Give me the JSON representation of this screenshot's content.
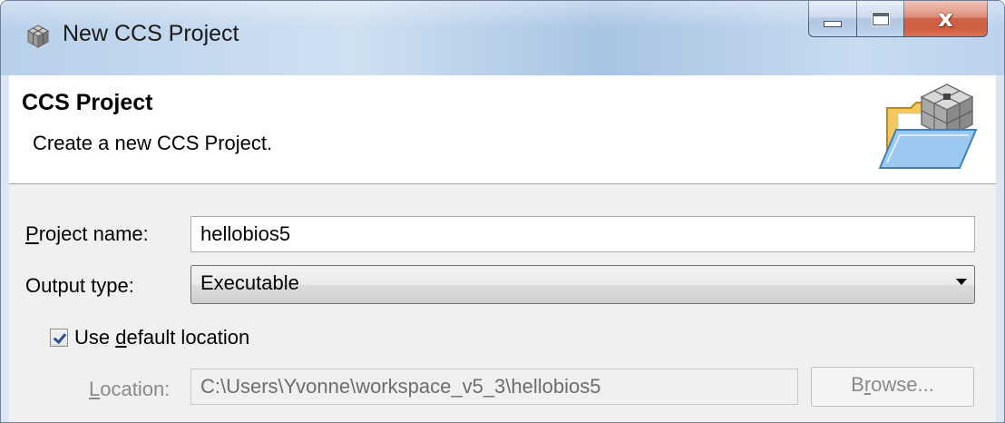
{
  "window": {
    "title": "New CCS Project",
    "icon": "ccs-app-icon",
    "controls": {
      "minimize": "minimize-icon",
      "maximize": "maximize-icon",
      "close_glyph": "x"
    }
  },
  "header": {
    "title": "CCS Project",
    "description": "Create a new CCS Project.",
    "icon": "folder-cube-wizard-icon"
  },
  "form": {
    "project_name": {
      "label_accel": "P",
      "label_rest": "roject name:",
      "value": "hellobios5"
    },
    "output_type": {
      "label": "Output type:",
      "selected": "Executable"
    },
    "default_location": {
      "checked": true,
      "label_pre": "Use ",
      "label_accel": "d",
      "label_post": "efault location"
    },
    "location": {
      "label_accel": "L",
      "label_rest": "ocation:",
      "value": "C:\\Users\\Yvonne\\workspace_v5_3\\hellobios5",
      "enabled": false
    },
    "browse_button": {
      "label_pre": "B",
      "label_accel": "r",
      "label_post": "owse...",
      "enabled": false
    }
  },
  "colors": {
    "titlebar": "#b9d0ea",
    "close_button": "#c74b2f",
    "dialog_background": "#f0f0f0",
    "disabled_text": "#8a8a8a"
  }
}
